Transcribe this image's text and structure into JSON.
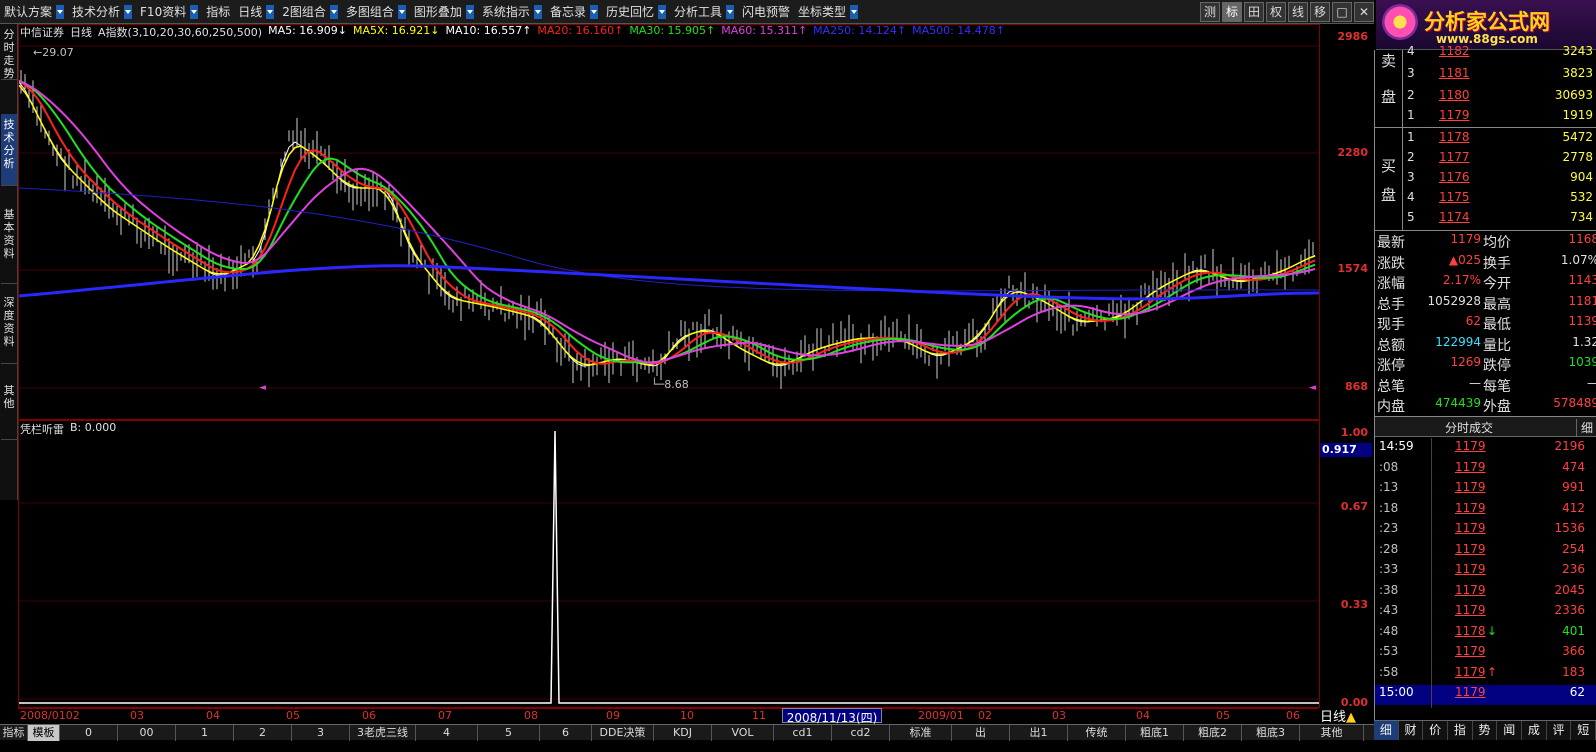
{
  "menubar": {
    "items": [
      "默认方案",
      "技术分析",
      "F10资料",
      "指标",
      "日线",
      "2图组合",
      "多图组合",
      "图形叠加",
      "系统指示",
      "备忘录",
      "历史回忆",
      "分析工具",
      "闪电预警",
      "坐标类型"
    ],
    "right_tools": [
      "测",
      "标",
      "田",
      "权",
      "线",
      "移",
      "□",
      "✕"
    ]
  },
  "logo": {
    "title": "分析家公式网",
    "url": "www.88gs.com"
  },
  "sidebar": {
    "tabs": [
      "分时走势",
      "技术分析",
      "基本资料",
      "深度资料",
      "其他"
    ]
  },
  "chart_header": {
    "stock": "中信证券",
    "period": "日线",
    "indicator": "A指数(3,10,20,30,60,250,500)",
    "ma_items": [
      {
        "label": "MA5: 16.909↓",
        "color": "#ffffff"
      },
      {
        "label": "MA5X: 16.921↓",
        "color": "#ffff00"
      },
      {
        "label": "MA10: 16.557↑",
        "color": "#ffffff"
      },
      {
        "label": "MA20: 16.160↑",
        "color": "#ff2020"
      },
      {
        "label": "MA30: 15.905↑",
        "color": "#20e020"
      },
      {
        "label": "MA60: 15.311↑",
        "color": "#e040e0"
      },
      {
        "label": "MA250: 14.124↑",
        "color": "#3030ff"
      },
      {
        "label": "MA500: 14.478↑",
        "color": "#3030ff"
      }
    ],
    "high_label": "29.07",
    "low_label": "8.68"
  },
  "main_scale": [
    "2986",
    "2280",
    "1574",
    "868"
  ],
  "sub_indicator": {
    "name": "凭栏听雷",
    "value_label": "B: 0.000",
    "current": "0.917"
  },
  "sub_scale": [
    "1.00",
    "0.67",
    "0.33",
    "0.00"
  ],
  "dates": [
    "2008/0102",
    "03",
    "04",
    "05",
    "06",
    "07",
    "08",
    "09",
    "10",
    "11",
    "2008/11/13(四)",
    "12",
    "2009/01",
    "02",
    "03",
    "04",
    "05",
    "06"
  ],
  "period_label": "日线",
  "bottom_tabs": [
    "指标",
    "模板",
    "0",
    "00",
    "1",
    "2",
    "3",
    "3老虎三线",
    "4",
    "5",
    "6",
    "DDE决策",
    "KDJ",
    "VOL",
    "cd1",
    "cd2",
    "标准",
    "出",
    "出1",
    "传统",
    "粗底1",
    "粗底2",
    "粗底3",
    "其他"
  ],
  "order_book": {
    "sell_label": "卖盘",
    "buy_label": "买盘",
    "sell": [
      {
        "lvl": "4",
        "price": "1182",
        "vol": "3243"
      },
      {
        "lvl": "3",
        "price": "1181",
        "vol": "3823"
      },
      {
        "lvl": "2",
        "price": "1180",
        "vol": "30693"
      },
      {
        "lvl": "1",
        "price": "1179",
        "vol": "1919"
      }
    ],
    "buy": [
      {
        "lvl": "1",
        "price": "1178",
        "vol": "5472"
      },
      {
        "lvl": "2",
        "price": "1177",
        "vol": "2778"
      },
      {
        "lvl": "3",
        "price": "1176",
        "vol": "904"
      },
      {
        "lvl": "4",
        "price": "1175",
        "vol": "532"
      },
      {
        "lvl": "5",
        "price": "1174",
        "vol": "734"
      }
    ]
  },
  "quotes": [
    {
      "l": "最新",
      "v": "1179",
      "vc": "#ff4040",
      "l2": "均价",
      "v2": "1168",
      "v2c": "#ff4040"
    },
    {
      "l": "涨跌",
      "v": "▲025",
      "vc": "#ff4040",
      "l2": "换手",
      "v2": "1.07%",
      "v2c": "#e0e0e0"
    },
    {
      "l": "涨幅",
      "v": "2.17%",
      "vc": "#ff4040",
      "l2": "今开",
      "v2": "1143",
      "v2c": "#ff4040"
    },
    {
      "l": "总手",
      "v": "1052928",
      "vc": "#e0e0e0",
      "l2": "最高",
      "v2": "1181",
      "v2c": "#ff4040"
    },
    {
      "l": "现手",
      "v": "62",
      "vc": "#ff4040",
      "l2": "最低",
      "v2": "1139",
      "v2c": "#ff4040"
    },
    {
      "l": "总额",
      "v": "122994",
      "vc": "#40e0ff",
      "l2": "量比",
      "v2": "1.32",
      "v2c": "#e0e0e0"
    },
    {
      "l": "涨停",
      "v": "1269",
      "vc": "#ff4040",
      "l2": "跌停",
      "v2": "1039",
      "v2c": "#20e020"
    },
    {
      "l": "总笔",
      "v": "—",
      "vc": "#e0e0e0",
      "l2": "每笔",
      "v2": "—",
      "v2c": "#e0e0e0"
    },
    {
      "l": "内盘",
      "v": "474439",
      "vc": "#20e020",
      "l2": "外盘",
      "v2": "578489",
      "v2c": "#ff4040"
    }
  ],
  "ticks_header": {
    "title": "分时成交",
    "detail": "细"
  },
  "ticks": [
    {
      "t": "14:59",
      "p": "1179",
      "v": "2196",
      "vc": "#ff4040",
      "a": ""
    },
    {
      "t": ":08",
      "p": "1179",
      "v": "474",
      "vc": "#ff4040",
      "a": ""
    },
    {
      "t": ":13",
      "p": "1179",
      "v": "991",
      "vc": "#ff4040",
      "a": ""
    },
    {
      "t": ":18",
      "p": "1179",
      "v": "412",
      "vc": "#ff4040",
      "a": ""
    },
    {
      "t": ":23",
      "p": "1179",
      "v": "1536",
      "vc": "#ff4040",
      "a": ""
    },
    {
      "t": ":28",
      "p": "1179",
      "v": "254",
      "vc": "#ff4040",
      "a": ""
    },
    {
      "t": ":33",
      "p": "1179",
      "v": "236",
      "vc": "#ff4040",
      "a": ""
    },
    {
      "t": ":38",
      "p": "1179",
      "v": "2045",
      "vc": "#ff4040",
      "a": ""
    },
    {
      "t": ":43",
      "p": "1179",
      "v": "2336",
      "vc": "#ff4040",
      "a": ""
    },
    {
      "t": ":48",
      "p": "1178",
      "v": "401",
      "vc": "#20e020",
      "a": "↓"
    },
    {
      "t": ":53",
      "p": "1179",
      "v": "366",
      "vc": "#ff4040",
      "a": ""
    },
    {
      "t": ":58",
      "p": "1179",
      "v": "183",
      "vc": "#ff4040",
      "a": "↑"
    },
    {
      "t": "15:00",
      "p": "1179",
      "v": "62",
      "vc": "#ffffff",
      "a": ""
    }
  ],
  "mini_icons": [
    "细",
    "财",
    "价",
    "指",
    "势",
    "闻",
    "成",
    "评",
    "短"
  ]
}
